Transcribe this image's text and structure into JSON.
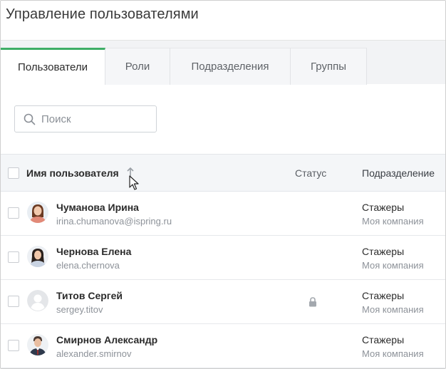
{
  "page": {
    "title": "Управление пользователями"
  },
  "tabs": [
    {
      "label": "Пользователи"
    },
    {
      "label": "Роли"
    },
    {
      "label": "Подразделения"
    },
    {
      "label": "Группы"
    }
  ],
  "search": {
    "placeholder": "Поиск",
    "icon": "search-icon"
  },
  "table": {
    "columns": {
      "name": "Имя пользователя",
      "status": "Статус",
      "department": "Подразделение"
    },
    "sort": {
      "column": "name",
      "direction": "asc"
    },
    "rows": [
      {
        "name": "Чуманова Ирина",
        "login": "irina.chumanova@ispring.ru",
        "department": "Стажеры",
        "department_parent": "Моя компания",
        "locked": false,
        "avatar": "photo-woman"
      },
      {
        "name": "Чернова Елена",
        "login": "elena.chernova",
        "department": "Стажеры",
        "department_parent": "Моя компания",
        "locked": false,
        "avatar": "photo-woman"
      },
      {
        "name": "Титов Сергей",
        "login": "sergey.titov",
        "department": "Стажеры",
        "department_parent": "Моя компания",
        "locked": true,
        "avatar": "placeholder-user"
      },
      {
        "name": "Смирнов Александр",
        "login": "alexander.smirnov",
        "department": "Стажеры",
        "department_parent": "Моя компания",
        "locked": false,
        "avatar": "photo-man"
      }
    ]
  },
  "colors": {
    "accent": "#3fae66",
    "header_bg": "#f4f6f8",
    "muted_text": "#8d9299"
  }
}
